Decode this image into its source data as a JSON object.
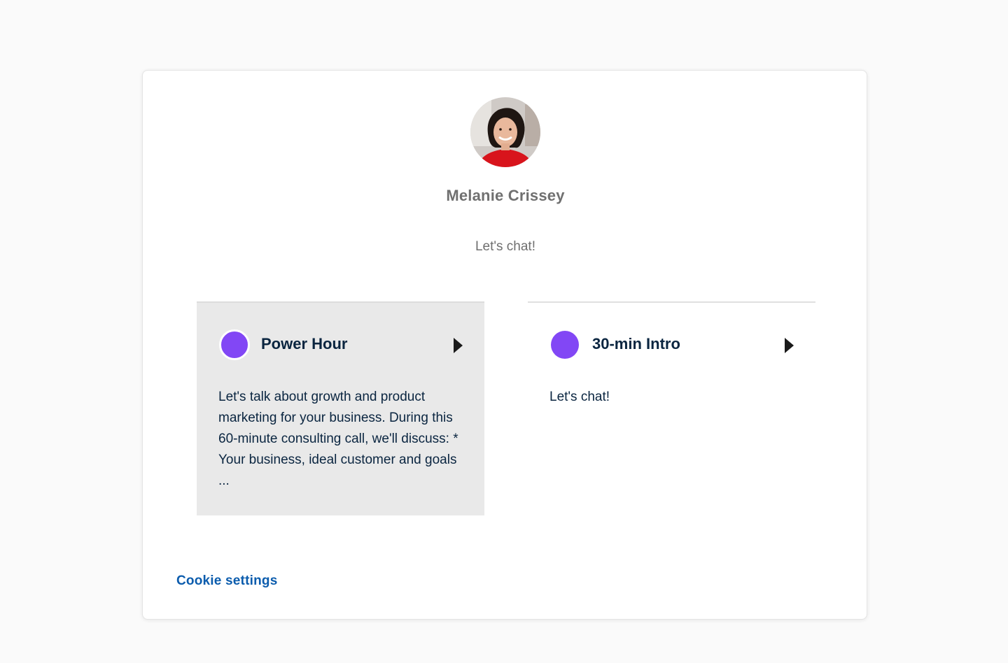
{
  "owner": {
    "name": "Melanie Crissey",
    "tagline": "Let's chat!"
  },
  "events": [
    {
      "title": "Power Hour",
      "description": "Let's talk about growth and product marketing for your business. During this 60-minute consulting call, we'll discuss: * Your business, ideal customer and goals ...",
      "color": "#8247f5",
      "icon": "caret-right-icon"
    },
    {
      "title": "30-min Intro",
      "description": "Let's chat!",
      "color": "#8247f5",
      "icon": "caret-right-icon"
    }
  ],
  "footer": {
    "cookie_label": "Cookie settings"
  },
  "colors": {
    "accent": "#8247f5",
    "link": "#0b5cad",
    "heading": "#0a2540"
  }
}
